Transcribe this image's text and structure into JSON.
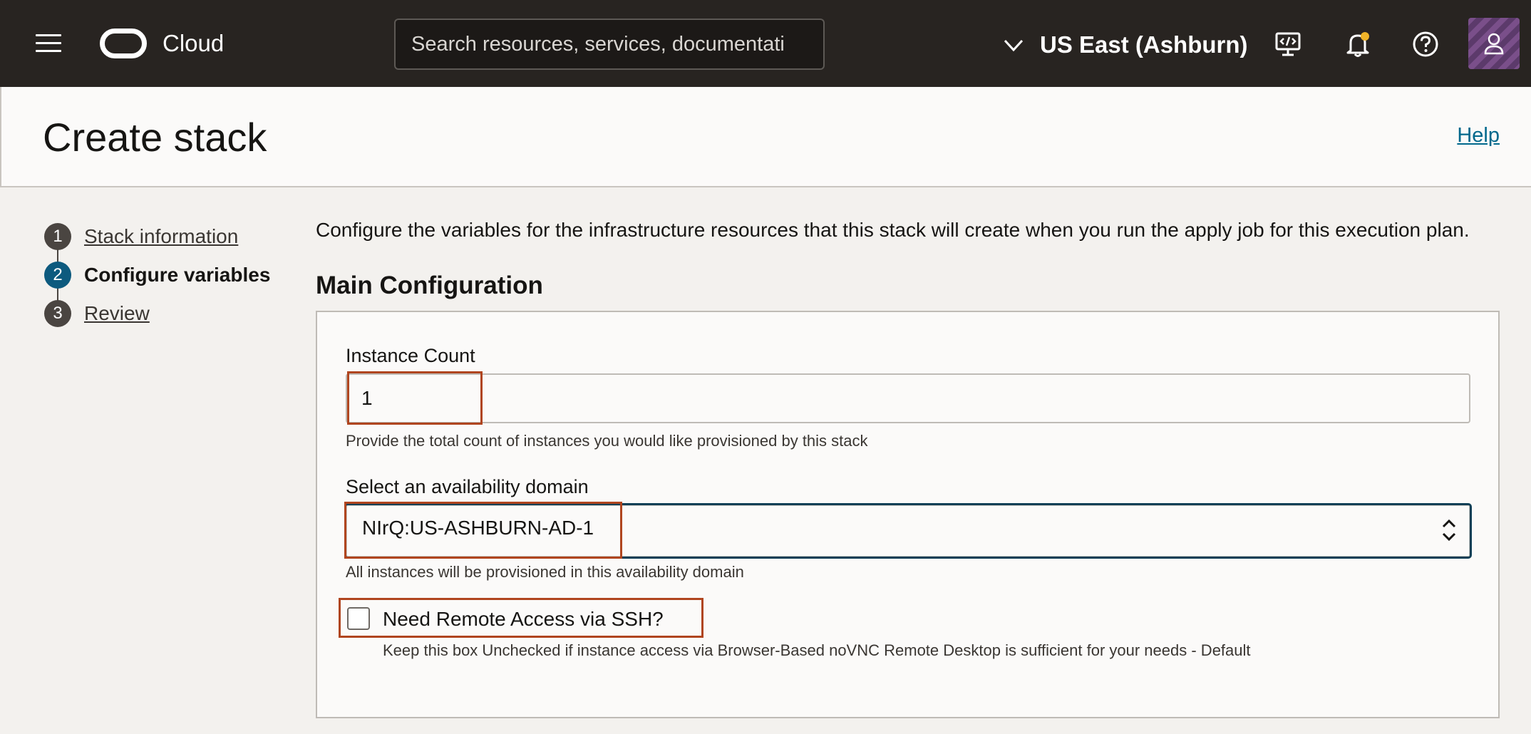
{
  "topbar": {
    "brand": "Cloud",
    "search_placeholder": "Search resources, services, documentati",
    "region": "US East (Ashburn)",
    "icons": [
      "menu-icon",
      "oracle-logo-icon",
      "chevron-down-icon",
      "developer-tools-icon",
      "bell-icon",
      "help-icon",
      "user-icon"
    ]
  },
  "header": {
    "title": "Create stack",
    "help_link": "Help"
  },
  "steps": [
    {
      "number": "1",
      "label": "Stack information",
      "state": "link"
    },
    {
      "number": "2",
      "label": "Configure variables",
      "state": "current"
    },
    {
      "number": "3",
      "label": "Review",
      "state": "link"
    }
  ],
  "main": {
    "intro": "Configure the variables for the infrastructure resources that this stack will create when you run the apply job for this execution plan.",
    "section_title": "Main Configuration",
    "instance_count": {
      "label": "Instance Count",
      "value": "1",
      "help": "Provide the total count of instances you would like provisioned by this stack"
    },
    "availability_domain": {
      "label": "Select an availability domain",
      "value": "NIrQ:US-ASHBURN-AD-1",
      "help": "All instances will be provisioned in this availability domain"
    },
    "ssh": {
      "label": "Need Remote Access via SSH?",
      "checked": false,
      "help": "Keep this box Unchecked if instance access via Browser-Based noVNC Remote Desktop is sufficient for your needs - Default"
    }
  },
  "colors": {
    "topbar": "#282421",
    "active_step": "#0d5a7e",
    "highlight": "#b0451f",
    "link": "#00688c"
  }
}
